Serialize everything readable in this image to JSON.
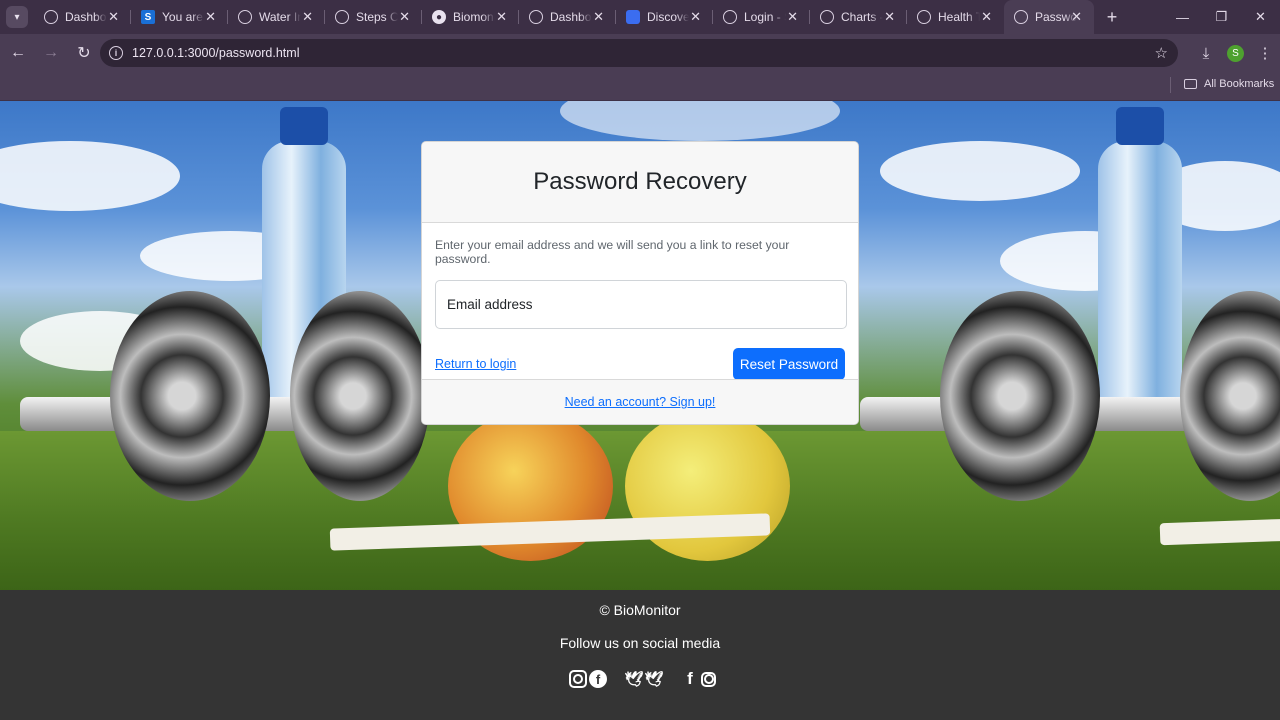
{
  "browser": {
    "tabs": [
      {
        "title": "Dashboard",
        "favicon": "globe-icon"
      },
      {
        "title": "You are",
        "favicon": "s-logo-icon"
      },
      {
        "title": "Water Intake",
        "favicon": "globe-icon"
      },
      {
        "title": "Steps Counter",
        "favicon": "globe-icon"
      },
      {
        "title": "Biomonitor",
        "favicon": "github-icon"
      },
      {
        "title": "Dashboard",
        "favicon": "globe-icon"
      },
      {
        "title": "Discover",
        "favicon": "doc-icon"
      },
      {
        "title": "Login - S",
        "favicon": "globe-icon"
      },
      {
        "title": "Charts -",
        "favicon": "globe-icon"
      },
      {
        "title": "Health T",
        "favicon": "globe-icon"
      },
      {
        "title": "Password",
        "favicon": "globe-icon",
        "active": true
      }
    ],
    "url": "127.0.0.1:3000/password.html",
    "profile_initial": "S",
    "bookmarks_label": "All Bookmarks"
  },
  "card": {
    "title": "Password Recovery",
    "hint": "Enter your email address and we will send you a link to reset your password.",
    "email_placeholder": "Email address",
    "return_link": "Return to login",
    "reset_button": "Reset Password",
    "signup_link": "Need an account? Sign up!"
  },
  "footer": {
    "copyright": "© BioMonitor",
    "follow": "Follow us on social media",
    "social": [
      "instagram-icon",
      "facebook-icon",
      "twitter-icon",
      "twitter-icon",
      "facebook-icon",
      "instagram-icon"
    ]
  },
  "colors": {
    "primary": "#0d6efd",
    "browser_chrome": "#4a3d54",
    "footer_bg": "#343434"
  }
}
